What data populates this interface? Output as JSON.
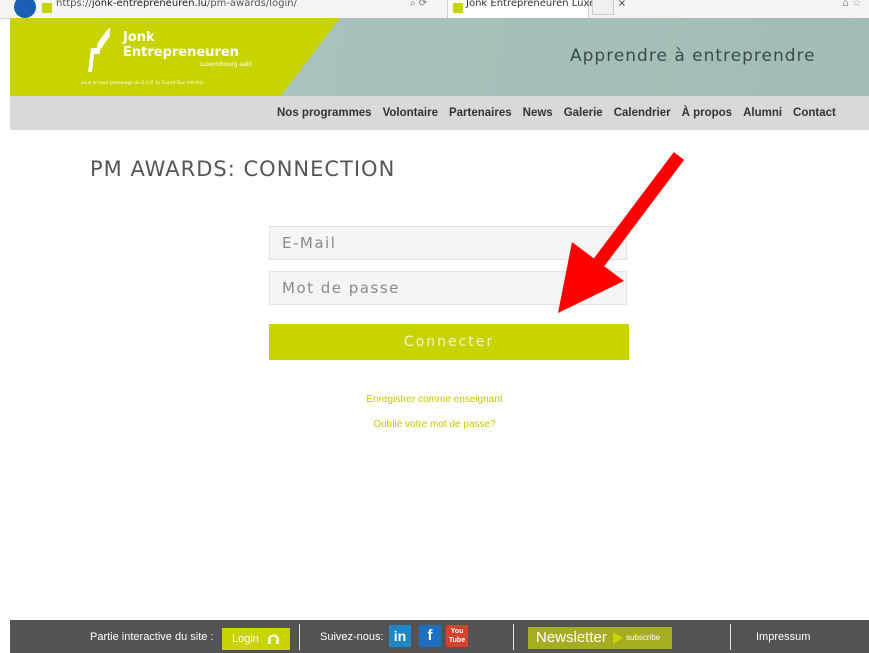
{
  "browser": {
    "url_prefix": "https://",
    "url_domain": "jonk-entrepreneuren.lu",
    "url_path": "/pm-awards/login/",
    "tab_title": "Jonk Entrepreneuren Luxem...",
    "tab_close": "×"
  },
  "header": {
    "logo_name_line1": "Jonk",
    "logo_name_line2": "Entrepreneuren",
    "logo_subtitle": "Luxembourg asbl",
    "logo_patronage": "sous le haut patronage de S.A.R. le Grand-Duc Héritier",
    "tagline": "Apprendre à entreprendre",
    "colors": {
      "accent": "#c8d400",
      "header_bg": "#a8c1bc"
    }
  },
  "nav": {
    "items": [
      {
        "label": "Nos programmes"
      },
      {
        "label": "Volontaire"
      },
      {
        "label": "Partenaires"
      },
      {
        "label": "News"
      },
      {
        "label": "Galerie"
      },
      {
        "label": "Calendrier"
      },
      {
        "label": "À propos"
      },
      {
        "label": "Alumni"
      },
      {
        "label": "Contact"
      }
    ]
  },
  "main": {
    "title": "PM AWARDS: CONNECTION",
    "email_placeholder": "E-Mail",
    "password_placeholder": "Mot de passe",
    "connect_label": "Connecter",
    "register_link": "Enregistrer comme enseignant",
    "forgot_link": "Oublié votre mot de passe?"
  },
  "annotation": {
    "arrow_color": "#ff0000",
    "icon": "red-arrow-icon"
  },
  "footer": {
    "interactive_label": "Partie interactive du site :",
    "login_label": "Login",
    "follow_label": "Suivez-nous:",
    "linkedin": "in",
    "facebook": "f",
    "youtube_top": "You",
    "youtube_bottom": "Tube",
    "newsletter_label": "Newsletter",
    "subscribe_label": "subscribe",
    "impressum_label": "Impressum"
  }
}
